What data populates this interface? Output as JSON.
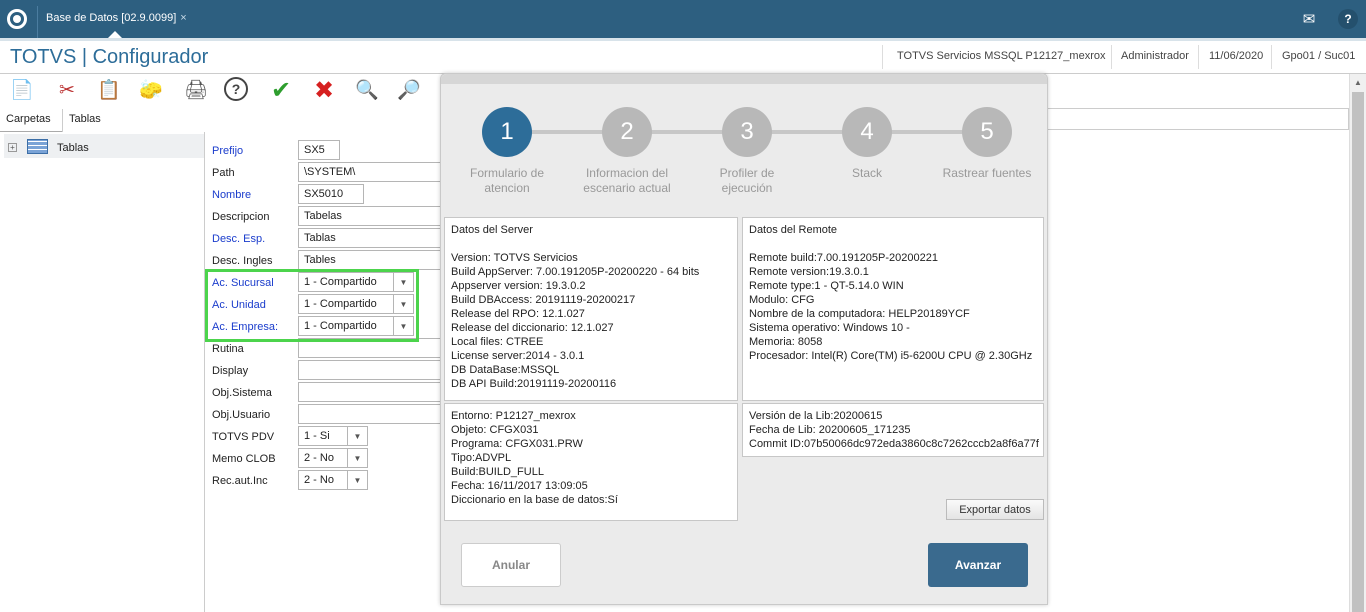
{
  "tab": {
    "title": "Base de Datos [02.9.0099]",
    "close": "×"
  },
  "topbar": {
    "mail_icon": "✉",
    "help_icon": "?"
  },
  "header": {
    "title": "TOTVS | Configurador",
    "server": "TOTVS Servicios MSSQL P12127_mexrox",
    "user": "Administrador",
    "date": "11/06/2020",
    "branch": "Gpo01 / Suc01"
  },
  "toolbar": {
    "icons": [
      "document-icon",
      "scissors-icon",
      "paste-icon",
      "eraser-icon",
      "print-icon",
      "help-icon",
      "check-icon",
      "cancel-icon",
      "search-icon",
      "search-next-icon"
    ],
    "glyphs": [
      "📄",
      "✂",
      "📋",
      "🧽",
      "🖨",
      "?",
      "✔",
      "✖",
      "🔍",
      "🔎"
    ]
  },
  "panel": {
    "folders_label": "Carpetas",
    "tab_label": "Tablas"
  },
  "tree": {
    "root_label": "Tablas"
  },
  "form": {
    "prefix": {
      "label": "Prefijo",
      "value": "SX5"
    },
    "path": {
      "label": "Path",
      "value": "\\SYSTEM\\"
    },
    "name": {
      "label": "Nombre",
      "value": "SX5010"
    },
    "descripcion": {
      "label": "Descripcion",
      "value": "Tabelas"
    },
    "desc_esp": {
      "label": "Desc. Esp.",
      "value": "Tablas"
    },
    "desc_ingles": {
      "label": "Desc. Ingles",
      "value": "Tables"
    },
    "ac_sucursal": {
      "label": "Ac. Sucursal",
      "value": "1 - Compartido"
    },
    "ac_unidad": {
      "label": "Ac. Unidad",
      "value": "1 - Compartido"
    },
    "ac_empresa": {
      "label": "Ac. Empresa:",
      "value": "1 - Compartido"
    },
    "rutina": {
      "label": "Rutina",
      "value": ""
    },
    "display": {
      "label": "Display",
      "value": ""
    },
    "obj_sistema": {
      "label": "Obj.Sistema",
      "value": ""
    },
    "obj_usuario": {
      "label": "Obj.Usuario",
      "value": ""
    },
    "totvs_pdv": {
      "label": "TOTVS PDV",
      "value": "1 - Si"
    },
    "memo_clob": {
      "label": "Memo CLOB",
      "value": "2 - No"
    },
    "rec_aut_inc": {
      "label": "Rec.aut.Inc",
      "value": "2 - No"
    }
  },
  "dialog": {
    "steps": [
      {
        "num": "1",
        "label": "Formulario de atencion"
      },
      {
        "num": "2",
        "label": "Informacion del escenario actual"
      },
      {
        "num": "3",
        "label": "Profiler de ejecución"
      },
      {
        "num": "4",
        "label": "Stack"
      },
      {
        "num": "5",
        "label": "Rastrear fuentes"
      }
    ],
    "server_box": [
      "Datos del Server",
      "",
      "Version: TOTVS Servicios",
      "Build AppServer: 7.00.191205P-20200220 - 64 bits",
      "Appserver version: 19.3.0.2",
      "Build DBAccess: 20191119-20200217",
      "Release del RPO:  12.1.027",
      "Release del diccionario: 12.1.027",
      "Local files: CTREE",
      "License server:2014 - 3.0.1",
      "DB DataBase:MSSQL",
      "DB API Build:20191119-20200116"
    ],
    "remote_box": [
      "Datos del Remote",
      "",
      "Remote build:7.00.191205P-20200221",
      "Remote version:19.3.0.1",
      "Remote type:1 - QT-5.14.0 WIN",
      "Modulo: CFG",
      "Nombre de la computadora: HELP20189YCF",
      "Sistema operativo: Windows 10 -",
      "Memoria: 8058",
      "Procesador: Intel(R) Core(TM) i5-6200U CPU @ 2.30GHz"
    ],
    "env_box": [
      "Entorno: P12127_mexrox",
      "Objeto: CFGX031",
      "Programa: CFGX031.PRW",
      "Tipo:ADVPL",
      "Build:BUILD_FULL",
      "Fecha: 16/11/2017 13:09:05",
      "Diccionario en la base de datos:Sí"
    ],
    "lib_box": [
      "Versión de la Lib:20200615",
      "Fecha de Lib: 20200605_171235",
      "Commit ID:07b50066dc972eda3860c8c7262cccb2a8f6a77f"
    ],
    "export_label": "Exportar datos",
    "cancel_label": "Anular",
    "next_label": "Avanzar"
  }
}
